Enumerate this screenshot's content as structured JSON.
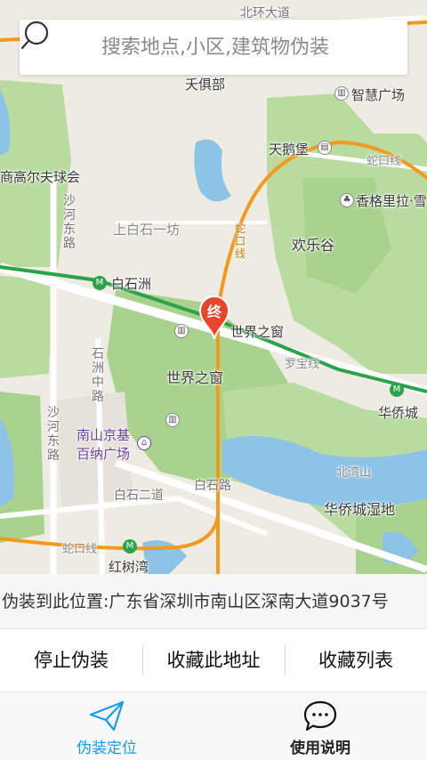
{
  "search": {
    "placeholder": "搜索地点,小区,建筑物伪装"
  },
  "map": {
    "marker_label": "终",
    "labels": {
      "north_ring": "北环大道",
      "tianjubu": "夭俱部",
      "zhihui": "智慧广场",
      "tianegu": "天鹅堡",
      "shekou_line_top": "蛇口线",
      "golf": "商高尔夫球会",
      "shangrila": "香格里拉·雪",
      "shangbaishi": "上白石一坊",
      "happy_valley": "欢乐谷",
      "baishizhou": "白石洲",
      "window_station": "世界之窗",
      "window_park": "世界之窗",
      "luobao_line": "罗宝线",
      "ocs": "华侨城",
      "nanshan_line1": "南山京基",
      "nanshan_line2": "百纳广场",
      "baishi_road": "白石路",
      "baishi_er": "白石二道",
      "ocs_wetland": "华侨城湿地",
      "shekou_line_bottom": "蛇口线",
      "hongshuwan": "红树湾",
      "beiguan": "北湾山"
    },
    "vertical_labels": {
      "shahe_east": "沙河东路",
      "shizhou": "石洲中路",
      "shahe_east_2": "沙河东路",
      "line_vertical": "蛇口线"
    }
  },
  "address": {
    "text": "伪装到此位置:广东省深圳市南山区深南大道9037号"
  },
  "actions": {
    "stop": "停止伪装",
    "favorite": "收藏此地址",
    "favorites_list": "收藏列表"
  },
  "nav": {
    "locate": "伪装定位",
    "help": "使用说明"
  },
  "colors": {
    "accent": "#1a9be6",
    "pin": "#e8452c",
    "metro_green": "#2aa34a",
    "metro_orange": "#f39a1e"
  }
}
